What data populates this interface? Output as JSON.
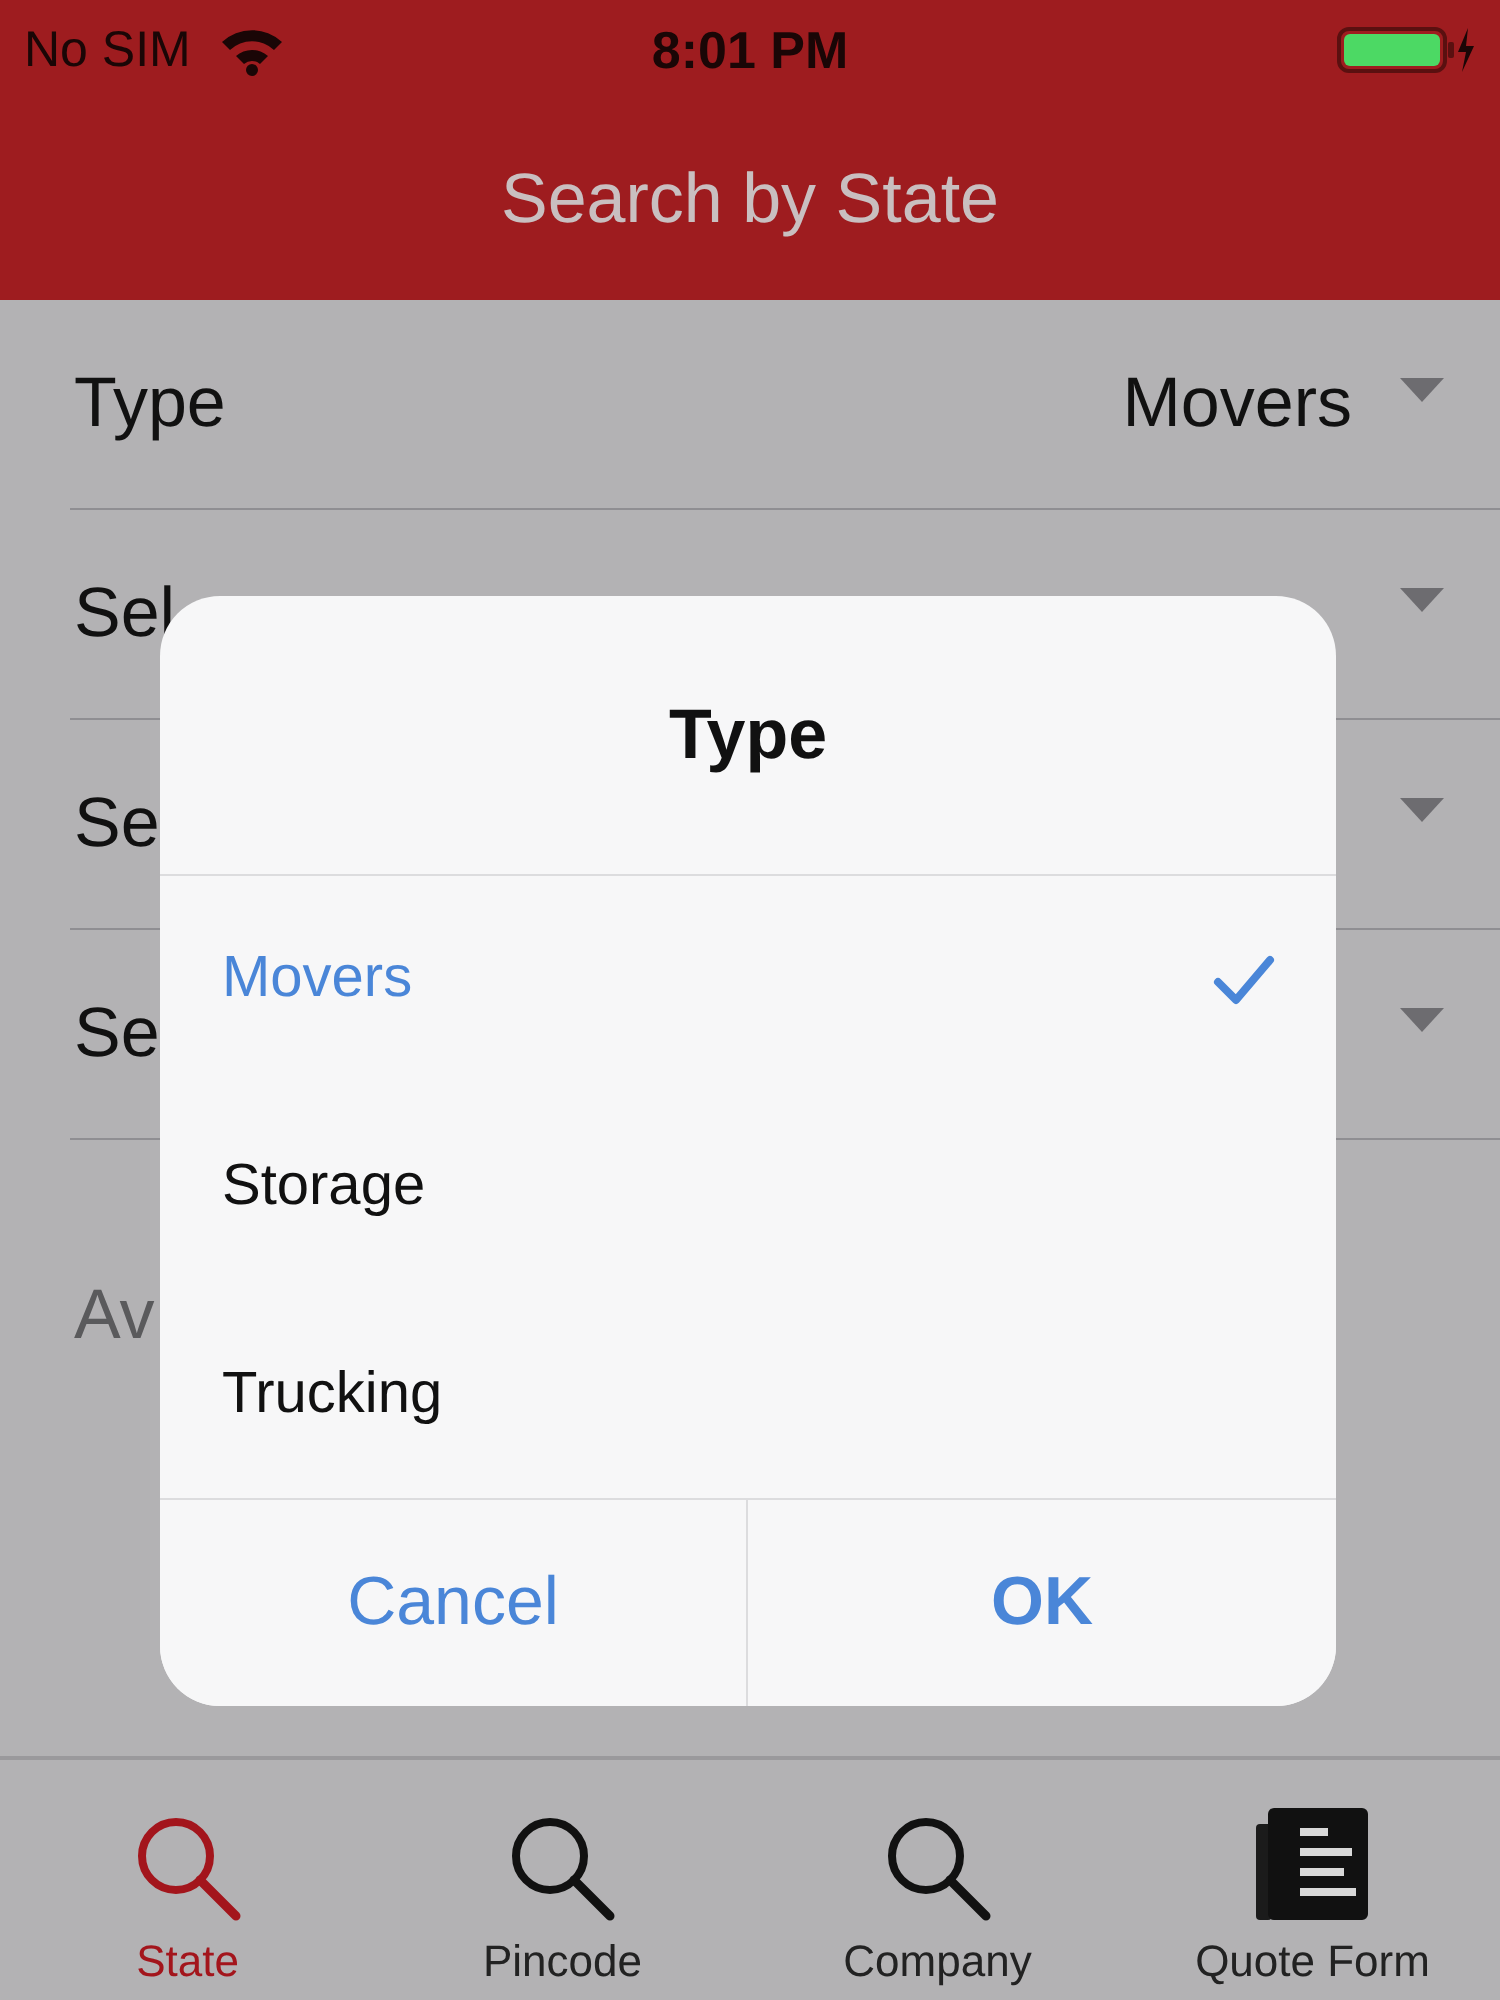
{
  "status_bar": {
    "carrier": "No SIM",
    "time": "8:01 PM"
  },
  "nav_bar": {
    "title": "Search by State"
  },
  "form_rows": [
    {
      "label": "Type",
      "value": "Movers"
    },
    {
      "label": "Sel"
    },
    {
      "label": "Se"
    },
    {
      "label": "Se"
    }
  ],
  "partial_text": "Av",
  "dialog": {
    "title": "Type",
    "options": [
      {
        "label": "Movers",
        "selected": true
      },
      {
        "label": "Storage",
        "selected": false
      },
      {
        "label": "Trucking",
        "selected": false
      }
    ],
    "buttons": [
      {
        "label": "Cancel",
        "kind": "cancel"
      },
      {
        "label": "OK",
        "kind": "confirm"
      }
    ]
  },
  "tab_bar": {
    "tabs": [
      {
        "label": "State",
        "kind": "search",
        "selected": true
      },
      {
        "label": "Pincode",
        "kind": "search",
        "selected": false
      },
      {
        "label": "Company",
        "kind": "search",
        "selected": false
      },
      {
        "label": "Quote Form",
        "kind": "document",
        "selected": false
      }
    ]
  }
}
